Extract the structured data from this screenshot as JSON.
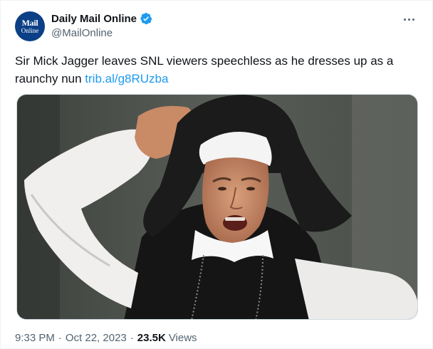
{
  "author": {
    "avatar_line1": "Mail",
    "avatar_line2": "Online",
    "display_name": "Daily Mail Online",
    "handle": "@MailOnline",
    "verified": true
  },
  "tweet": {
    "text": "Sir Mick Jagger leaves SNL viewers speechless as he dresses up as a raunchy nun ",
    "link_text": "trib.al/g8RUzba"
  },
  "media": {
    "description_icon": "photo-nun-costume"
  },
  "meta": {
    "time": "9:33 PM",
    "date": "Oct 22, 2023",
    "separator": "·",
    "views_count": "23.5K",
    "views_label": "Views"
  },
  "colors": {
    "link": "#1d9bf0",
    "verified": "#1d9bf0",
    "secondary_text": "#536471",
    "avatar_bg": "#0b3f86"
  }
}
